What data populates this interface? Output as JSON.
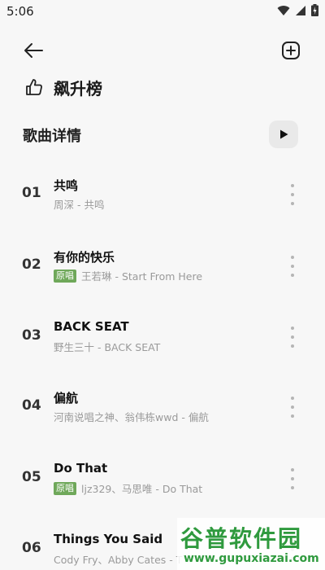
{
  "status_bar": {
    "time": "5:06"
  },
  "header": {
    "chart_title": "飙升榜",
    "section_title": "歌曲详情"
  },
  "songs": [
    {
      "num": "01",
      "name": "共鸣",
      "tag": "",
      "artist": "周深 - 共鸣"
    },
    {
      "num": "02",
      "name": "有你的快乐",
      "tag": "原唱",
      "artist": "王若琳 - Start From Here"
    },
    {
      "num": "03",
      "name": "BACK SEAT",
      "tag": "",
      "artist": "野生三十 - BACK SEAT"
    },
    {
      "num": "04",
      "name": "偏航",
      "tag": "",
      "artist": "河南说唱之神、翁伟栋wwd - 偏航"
    },
    {
      "num": "05",
      "name": "Do That",
      "tag": "原唱",
      "artist": "ljz329、马思唯 - Do That"
    },
    {
      "num": "06",
      "name": "Things You Said",
      "tag": "",
      "artist": "Cody Fry、Abby Cates - T"
    }
  ],
  "watermark": {
    "main": "谷普软件园",
    "url": "www.gupuxiazai.com"
  },
  "colors": {
    "background": "#f7f7f7",
    "tag_green": "#6fa85a",
    "watermark_green": "#2f9a3e"
  }
}
